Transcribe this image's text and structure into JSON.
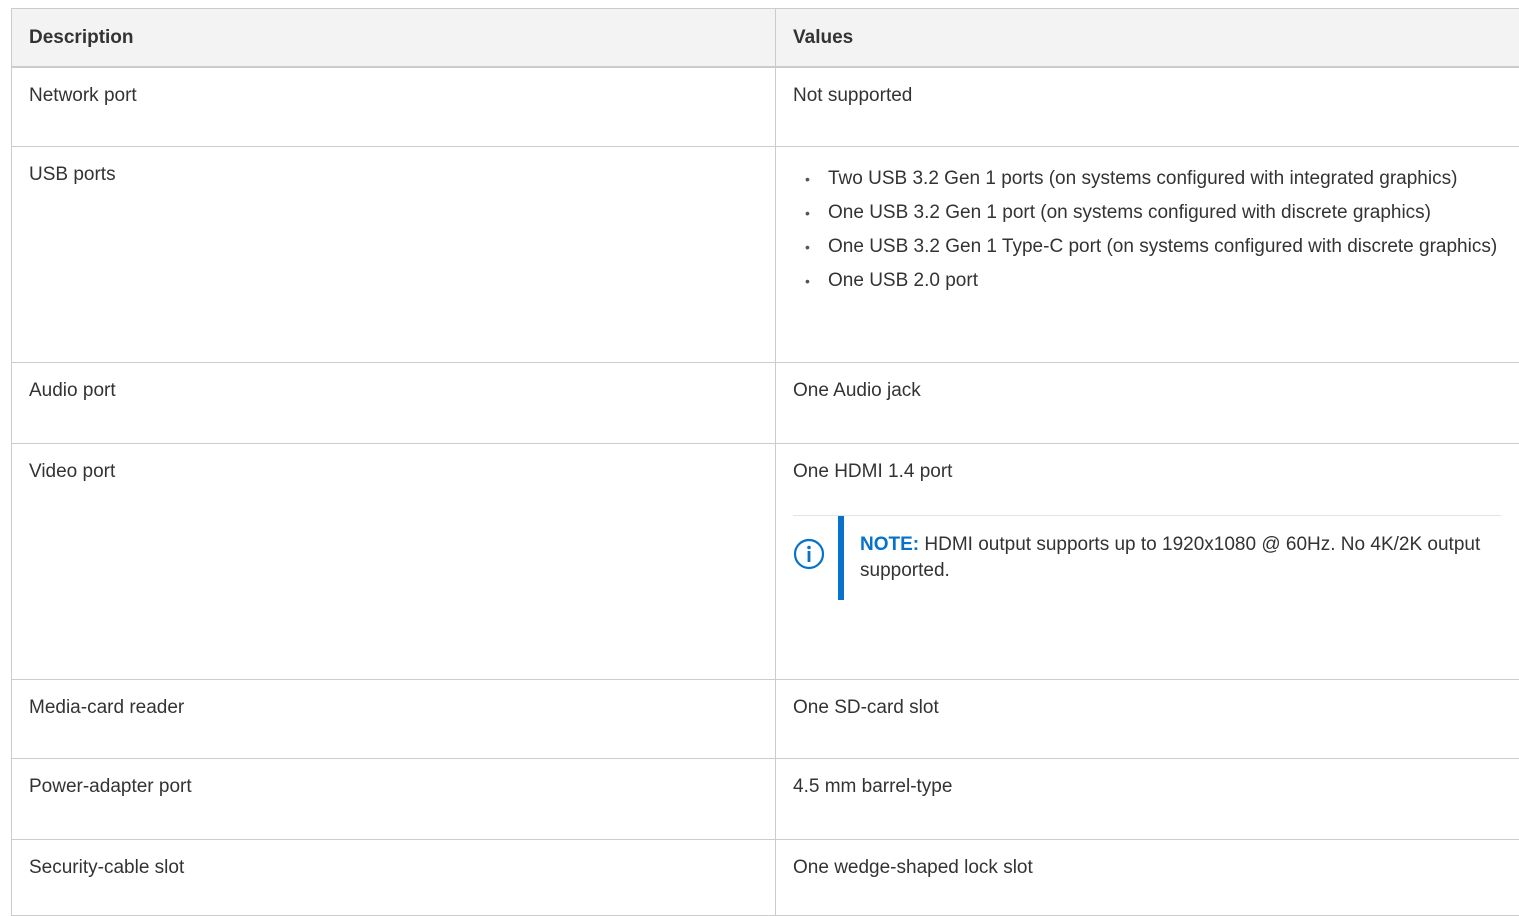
{
  "table": {
    "headers": {
      "description": "Description",
      "values": "Values"
    },
    "rows": {
      "network": {
        "description": "Network port",
        "value": "Not supported"
      },
      "usb": {
        "description": "USB ports",
        "items": [
          "Two USB 3.2 Gen 1 ports (on systems configured with integrated graphics)",
          "One USB 3.2 Gen 1 port (on systems configured with discrete graphics)",
          "One USB 3.2 Gen 1 Type-C port (on systems configured with discrete graphics)",
          "One USB 2.0 port"
        ]
      },
      "audio": {
        "description": "Audio port",
        "value": "One Audio jack"
      },
      "video": {
        "description": "Video port",
        "value": "One HDMI 1.4 port",
        "note": {
          "label": "NOTE:",
          "text": "HDMI output supports up to 1920x1080 @ 60Hz. No 4K/2K output supported.",
          "icon": "info-icon",
          "accent_color": "#0672cb"
        }
      },
      "media": {
        "description": "Media-card reader",
        "value": "One SD-card slot"
      },
      "power": {
        "description": "Power-adapter port",
        "value": "4.5 mm barrel-type"
      },
      "security": {
        "description": "Security-cable slot",
        "value": "One wedge-shaped lock slot"
      }
    }
  }
}
